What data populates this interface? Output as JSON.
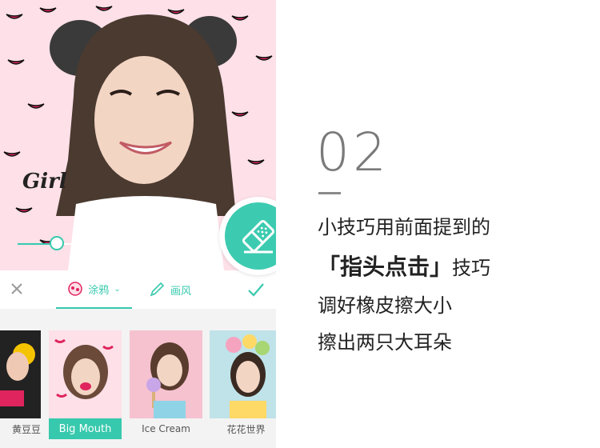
{
  "hero": {
    "number": "02",
    "line1": "小技巧用前面提到的",
    "line2_bold": "「指头点击」",
    "line2_rest": "技巧",
    "line3": "调好橡皮擦大小",
    "line4": "擦出两只大耳朵"
  },
  "editor": {
    "slider": {
      "level": 0.19
    },
    "tabs": {
      "doodle": "涂鸦",
      "style": "画风"
    },
    "stickers": [
      {
        "label": "黄豆豆",
        "active": false
      },
      {
        "label": "Big Mouth",
        "active": true
      },
      {
        "label": "Ice Cream",
        "active": false
      },
      {
        "label": "花花世界",
        "active": false
      }
    ],
    "photo_text": "Girl"
  },
  "colors": {
    "accent": "#37c9ad",
    "pattern_bg": "#fde0e8",
    "lips": "#e0245e"
  },
  "icons": [
    "close-icon",
    "doodle-icon",
    "brush-icon",
    "check-icon",
    "eraser-icon"
  ]
}
